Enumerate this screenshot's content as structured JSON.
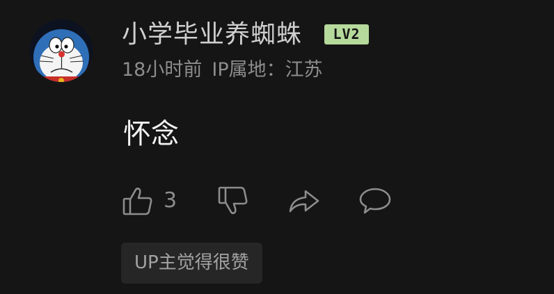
{
  "comment": {
    "avatar_label": "avatar",
    "username": "小学毕业养蜘蛛",
    "level": "LV2",
    "time": "18小时前",
    "ip_location": "IP属地：江苏",
    "content": "怀念",
    "like_count": "3",
    "up_badge": "UP主觉得很赞"
  },
  "icons": {
    "like": "thumbs-up-icon",
    "dislike": "thumbs-down-icon",
    "share": "share-icon",
    "reply": "reply-icon"
  },
  "colors": {
    "background": "#151515",
    "username": "#cfcfcf",
    "meta": "#8d8d8d",
    "content": "#f2f2f2",
    "level_badge": "#b6d99c",
    "up_badge_bg": "#262626"
  }
}
